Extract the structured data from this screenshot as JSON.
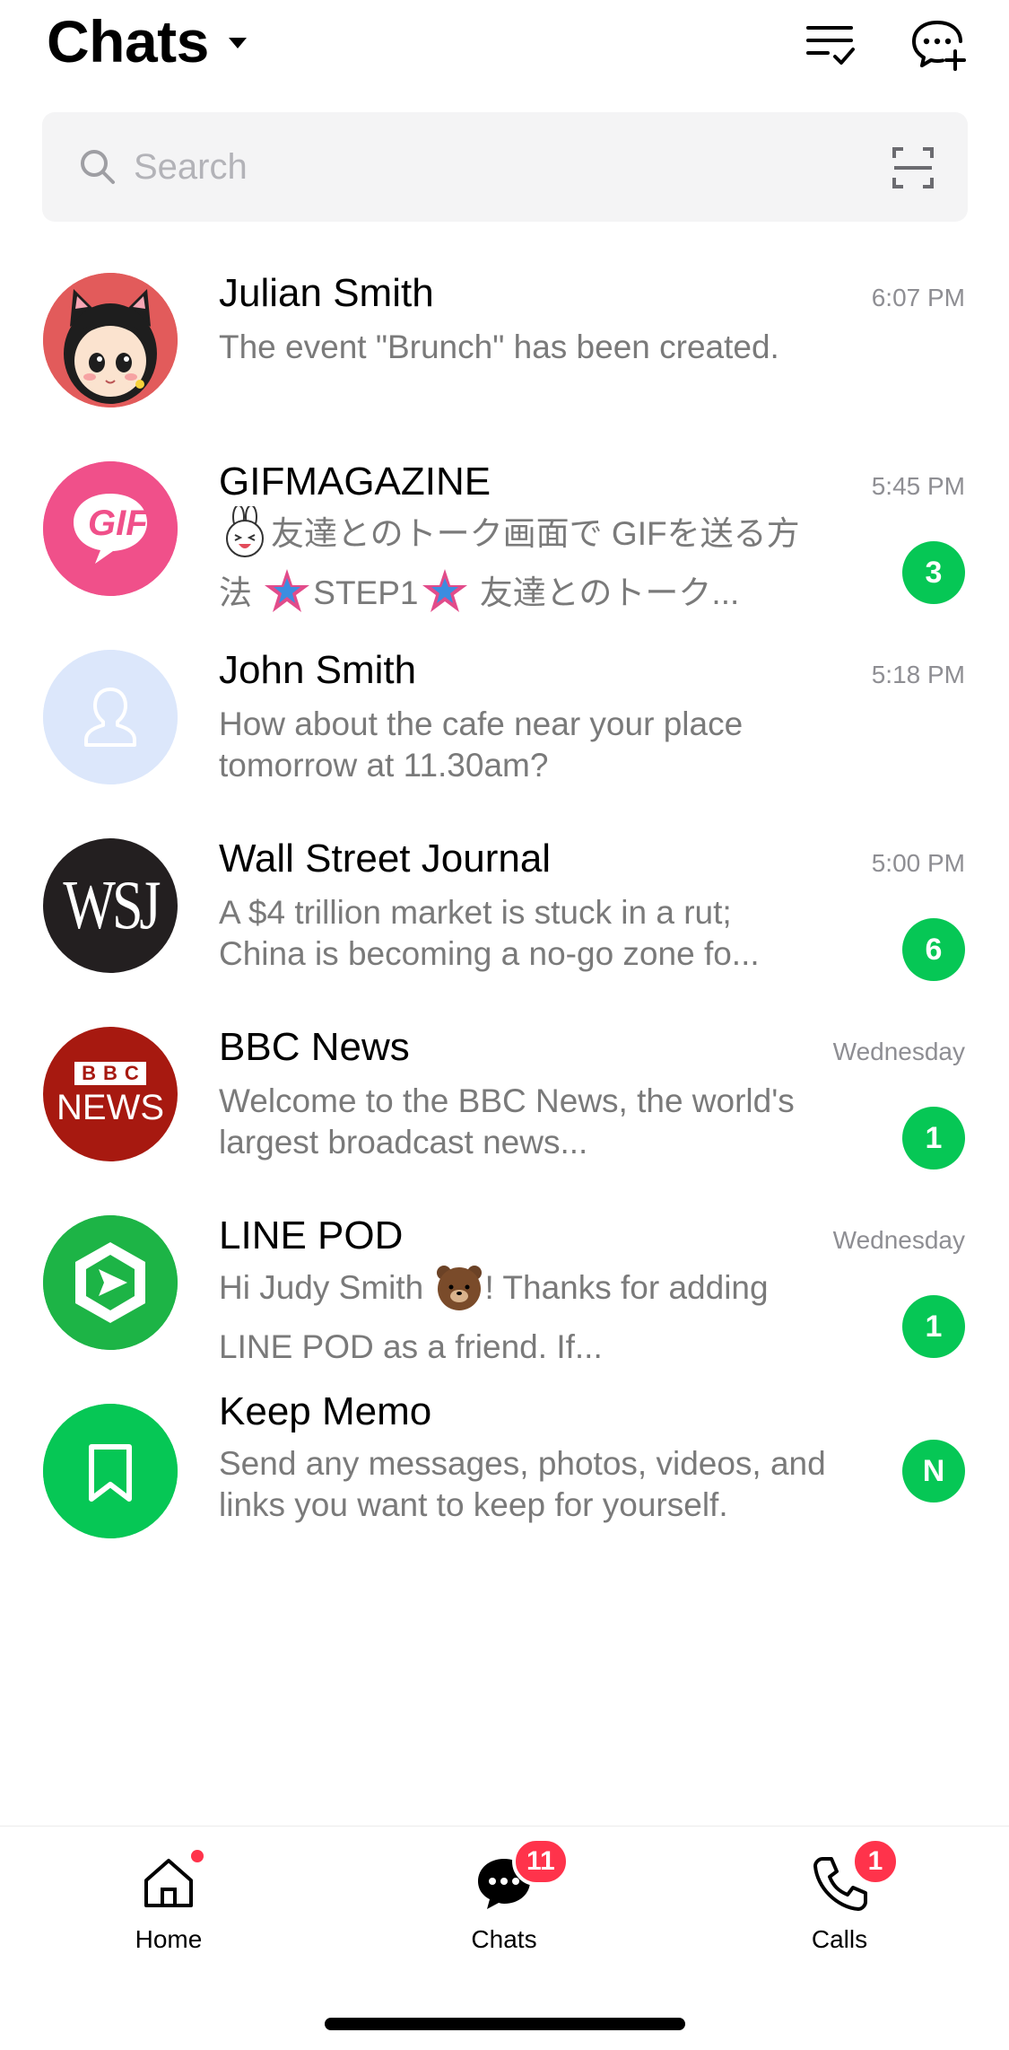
{
  "header": {
    "title": "Chats",
    "icons": {
      "edit_list": "checklist-icon",
      "new_chat": "new-chat-icon"
    }
  },
  "search": {
    "placeholder": "Search"
  },
  "chats": [
    {
      "name": "Julian Smith",
      "preview": "The event \"Brunch\" has been created.",
      "time": "6:07 PM",
      "unread": "",
      "avatar": "cat-girl-avatar"
    },
    {
      "name": "GIFMAGAZINE",
      "preview_parts": [
        "友達とのトーク画面で GIFを送る方法 ",
        "STEP1",
        " 友達とのトーク..."
      ],
      "time": "5:45 PM",
      "unread": "3",
      "avatar": "gif-logo",
      "avatar_text": "GIF"
    },
    {
      "name": "John Smith",
      "preview": "How about the cafe near your place tomorrow at 11.30am?",
      "time": "5:18 PM",
      "unread": "",
      "avatar": "default-user-avatar"
    },
    {
      "name": "Wall Street Journal",
      "preview": "A $4 trillion market is stuck in a rut; China is becoming a no-go zone fo...",
      "time": "5:00 PM",
      "unread": "6",
      "avatar": "wsj-logo",
      "avatar_text": "WSJ"
    },
    {
      "name": "BBC News",
      "preview": "Welcome to the BBC News, the world's largest broadcast news...",
      "time": "Wednesday",
      "unread": "1",
      "avatar": "bbc-news-logo",
      "avatar_text_top": "BBC",
      "avatar_text_bottom": "NEWS"
    },
    {
      "name": "LINE POD",
      "preview_before": "Hi Judy Smith ",
      "preview_after": "! Thanks for adding LINE POD as a friend. If...",
      "time": "Wednesday",
      "unread": "1",
      "avatar": "line-pod-logo"
    },
    {
      "name": "Keep Memo",
      "preview": "Send any messages, photos, videos, and links you want to keep for yourself.",
      "time": "",
      "unread": "N",
      "avatar": "bookmark-logo"
    }
  ],
  "tabs": [
    {
      "label": "Home",
      "icon": "home-icon",
      "dot": true
    },
    {
      "label": "Chats",
      "icon": "chat-bubble-icon",
      "badge": "11"
    },
    {
      "label": "Calls",
      "icon": "phone-icon",
      "badge": "1"
    }
  ],
  "colors": {
    "accent_green": "#06c755",
    "badge_red": "#ff334b",
    "gif_pink": "#f0508a",
    "bbc_red": "#a71910",
    "wsj_black": "#231f20"
  }
}
